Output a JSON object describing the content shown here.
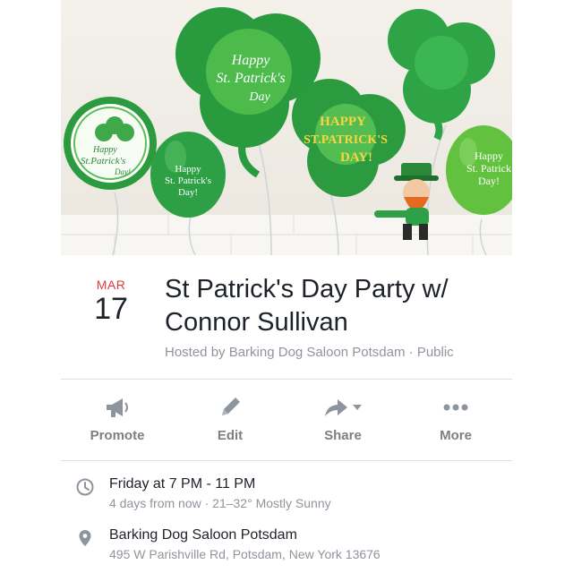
{
  "cover": {
    "balloon_texts": {
      "big_shamrock": [
        "Happy",
        "St. Patrick's",
        "Day"
      ],
      "left_round": [
        "Happy",
        "St.Patrick's",
        "Day!"
      ],
      "green_balloon": [
        "Happy",
        "St. Patrick's",
        "Day!"
      ],
      "mid_shamrock": [
        "HAPPY",
        "ST.PATRICK'S",
        "DAY!"
      ],
      "right_balloon": [
        "Happy",
        "St. Patrick",
        "Day!"
      ]
    }
  },
  "event": {
    "month": "MAR",
    "day": "17",
    "title": "St Patrick's Day Party w/ Connor Sullivan",
    "host_line": "Hosted by Barking Dog Saloon Potsdam · Public"
  },
  "actions": [
    {
      "label": "Promote",
      "icon": "megaphone-icon"
    },
    {
      "label": "Edit",
      "icon": "pencil-icon"
    },
    {
      "label": "Share",
      "icon": "share-arrow-icon"
    },
    {
      "label": "More",
      "icon": "more-dots-icon"
    }
  ],
  "details": {
    "time": {
      "main": "Friday at 7 PM - 11 PM",
      "sub": "4 days from now · 21–32° Mostly Sunny"
    },
    "location": {
      "main": "Barking Dog Saloon Potsdam",
      "sub": "495 W Parishville Rd, Potsdam, New York 13676"
    }
  },
  "colors": {
    "month": "#e0393e",
    "muted": "#90949c",
    "icon": "#8d949e"
  }
}
